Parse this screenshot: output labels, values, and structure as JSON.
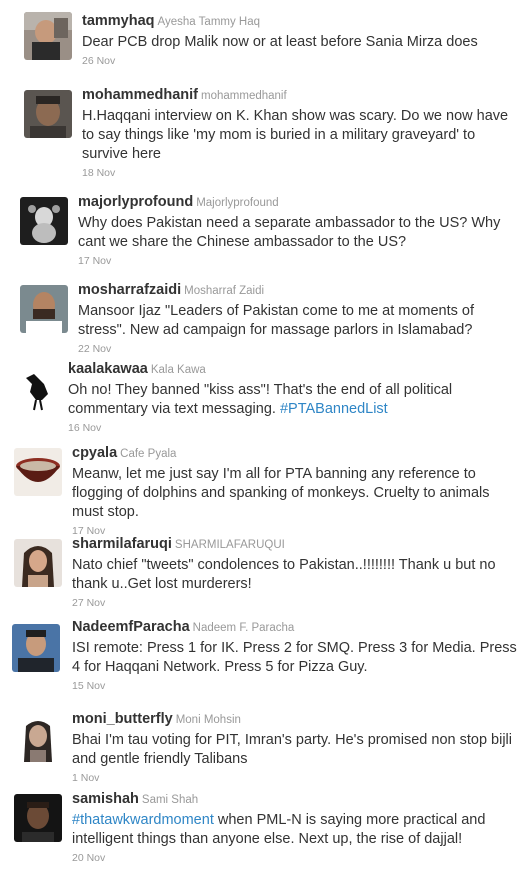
{
  "tweets": [
    {
      "handle": "tammyhaq",
      "name": "Ayesha Tammy Haq",
      "text": "Dear PCB drop Malik now or at least before Sania Mirza does",
      "date": "26 Nov",
      "avatar": "toddler-photo"
    },
    {
      "handle": "mohammedhanif",
      "name": "mohammedhanif",
      "text": "H.Haqqani interview on K. Khan show was scary. Do we now have to say things like 'my mom is buried in a military graveyard' to survive here",
      "date": "18 Nov",
      "avatar": "man-portrait"
    },
    {
      "handle": "majorlyprofound",
      "name": "Majorlyprofound",
      "text": "Why does Pakistan need a separate ambassador to the US? Why cant we share the Chinese ambassador to the US?",
      "date": "17 Nov",
      "avatar": "figurine-photo"
    },
    {
      "handle": "mosharrafzaidi",
      "name": "Mosharraf Zaidi",
      "text": "Mansoor Ijaz \"Leaders of Pakistan come to me at moments of stress\". New ad campaign for massage parlors in Islamabad?",
      "date": "22 Nov",
      "avatar": "man-portrait"
    },
    {
      "handle": "kaalakawaa",
      "name": "Kala Kawa",
      "text": "Oh no! They banned \"kiss ass\"! That's the end of all political commentary via text messaging. ",
      "hashtag": "#PTABannedList",
      "date": "16 Nov",
      "avatar": "crow-silhouette"
    },
    {
      "handle": "cpyala",
      "name": "Cafe Pyala",
      "text": "Meanw, let me just say I'm all for PTA banning any reference to flogging of dolphins and spanking of monkeys. Cruelty to animals must stop.",
      "date": "17 Nov",
      "avatar": "bowl-photo"
    },
    {
      "handle": "sharmilafaruqi",
      "name": "SHARMILAFARUQUI",
      "text": "Nato chief \"tweets\" condolences to Pakistan..!!!!!!!! Thank u but no thank u..Get lost murderers!",
      "date": "27 Nov",
      "avatar": "woman-portrait"
    },
    {
      "handle": "NadeemfParacha",
      "name": "Nadeem F. Paracha",
      "text": "ISI remote: Press 1 for IK. Press 2 for SMQ. Press 3 for Media. Press 4 for Haqqani Network. Press 5 for Pizza Guy.",
      "date": "15 Nov",
      "avatar": "man-portrait"
    },
    {
      "handle": "moni_butterfly",
      "name": "Moni Mohsin",
      "text": "Bhai I'm tau voting for PIT, Imran's party. He's promised non stop bijli and gentle friendly Talibans",
      "date": "1 Nov",
      "avatar": "woman-portrait"
    },
    {
      "handle": "samishah",
      "name": "Sami Shah",
      "hashtag_prefix": "#thatawkwardmoment",
      "text": " when PML-N is saying more practical and intelligent things than anyone else. Next up, the rise of dajjal!",
      "date": "20 Nov",
      "avatar": "man-portrait-dark"
    }
  ]
}
